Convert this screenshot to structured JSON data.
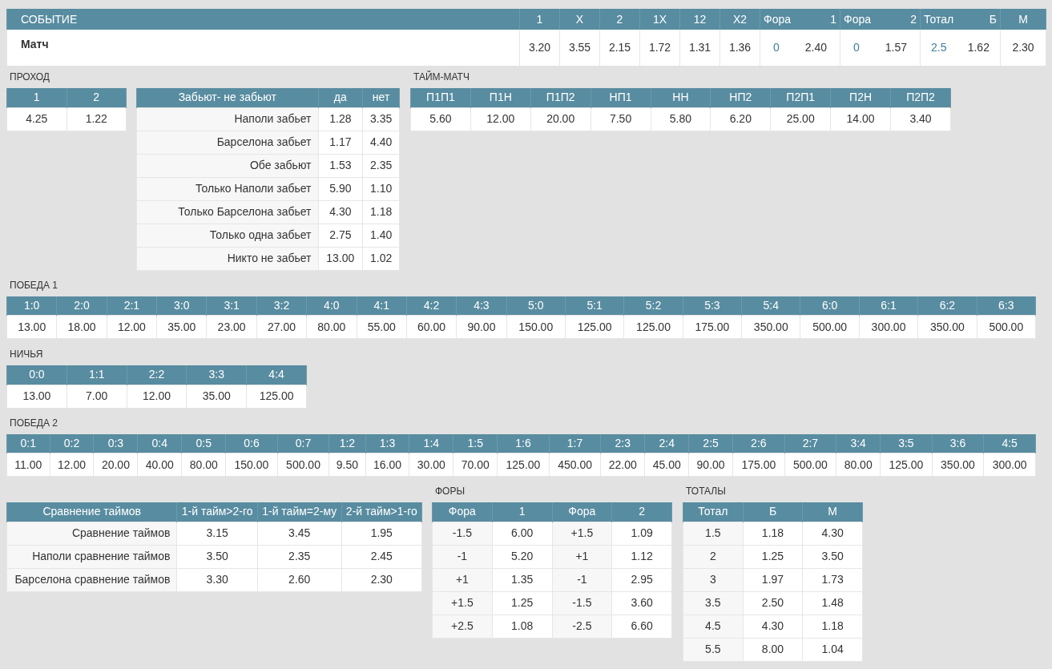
{
  "event": {
    "columns": [
      {
        "label": "СОБЫТИЕ"
      },
      {
        "label": "1"
      },
      {
        "label": "X"
      },
      {
        "label": "2"
      },
      {
        "label": "1X"
      },
      {
        "label": "12"
      },
      {
        "label": "X2"
      },
      {
        "label": "Фора",
        "label_2": "1"
      },
      {
        "label": "Фора",
        "label_2": "2"
      },
      {
        "label": "Тотал",
        "label_2": "Б"
      },
      {
        "label": "М"
      }
    ],
    "row": [
      {
        "kind": "name",
        "text": "Матч"
      },
      {
        "kind": "odd",
        "text": "3.20"
      },
      {
        "kind": "odd",
        "text": "3.55"
      },
      {
        "kind": "odd",
        "text": "2.15"
      },
      {
        "kind": "odd",
        "text": "1.72"
      },
      {
        "kind": "odd",
        "text": "1.31"
      },
      {
        "kind": "odd",
        "text": "1.36"
      },
      {
        "kind": "pair",
        "line": "0",
        "odd": "2.40"
      },
      {
        "kind": "pair",
        "line": "0",
        "odd": "1.57"
      },
      {
        "kind": "pair",
        "line": "2.5",
        "odd": "1.62"
      },
      {
        "kind": "odd",
        "text": "2.30"
      }
    ]
  },
  "passage": {
    "title": "ПРОХОД",
    "columns": [
      "1",
      "2"
    ],
    "rows": [
      [
        "4.25",
        "1.22"
      ]
    ]
  },
  "both_score": {
    "columns": [
      "Забьют- не забьют",
      "да",
      "нет"
    ],
    "rows": [
      [
        "Наполи забьет",
        "1.28",
        "3.35"
      ],
      [
        "Барселона забьет",
        "1.17",
        "4.40"
      ],
      [
        "Обе забьют",
        "1.53",
        "2.35"
      ],
      [
        "Только Наполи забьет",
        "5.90",
        "1.10"
      ],
      [
        "Только Барселона забьет",
        "4.30",
        "1.18"
      ],
      [
        "Только одна забьет",
        "2.75",
        "1.40"
      ],
      [
        "Никто не забьет",
        "13.00",
        "1.02"
      ]
    ]
  },
  "half_match": {
    "title": "ТАЙМ-МАТЧ",
    "columns": [
      "П1П1",
      "П1Н",
      "П1П2",
      "НП1",
      "НН",
      "НП2",
      "П2П1",
      "П2Н",
      "П2П2"
    ],
    "rows": [
      [
        "5.60",
        "12.00",
        "20.00",
        "7.50",
        "5.80",
        "6.20",
        "25.00",
        "14.00",
        "3.40"
      ]
    ]
  },
  "win_1": {
    "title": "ПОБЕДА 1",
    "columns": [
      "1:0",
      "2:0",
      "2:1",
      "3:0",
      "3:1",
      "3:2",
      "4:0",
      "4:1",
      "4:2",
      "4:3",
      "5:0",
      "5:1",
      "5:2",
      "5:3",
      "5:4",
      "6:0",
      "6:1",
      "6:2",
      "6:3"
    ],
    "rows": [
      [
        "13.00",
        "18.00",
        "12.00",
        "35.00",
        "23.00",
        "27.00",
        "80.00",
        "55.00",
        "60.00",
        "90.00",
        "150.00",
        "125.00",
        "125.00",
        "175.00",
        "350.00",
        "500.00",
        "300.00",
        "350.00",
        "500.00"
      ]
    ]
  },
  "draw": {
    "title": "НИЧЬЯ",
    "columns": [
      "0:0",
      "1:1",
      "2:2",
      "3:3",
      "4:4"
    ],
    "rows": [
      [
        "13.00",
        "7.00",
        "12.00",
        "35.00",
        "125.00"
      ]
    ]
  },
  "win_2": {
    "title": "ПОБЕДА 2",
    "columns": [
      "0:1",
      "0:2",
      "0:3",
      "0:4",
      "0:5",
      "0:6",
      "0:7",
      "1:2",
      "1:3",
      "1:4",
      "1:5",
      "1:6",
      "1:7",
      "2:3",
      "2:4",
      "2:5",
      "2:6",
      "2:7",
      "3:4",
      "3:5",
      "3:6",
      "4:5"
    ],
    "rows": [
      [
        "11.00",
        "12.00",
        "20.00",
        "40.00",
        "80.00",
        "150.00",
        "500.00",
        "9.50",
        "16.00",
        "30.00",
        "70.00",
        "125.00",
        "450.00",
        "22.00",
        "45.00",
        "90.00",
        "175.00",
        "500.00",
        "80.00",
        "125.00",
        "350.00",
        "300.00"
      ]
    ]
  },
  "halves": {
    "columns": [
      "Сравнение таймов",
      "1-й тайм>2-го",
      "1-й тайм=2-му",
      "2-й тайм>1-го"
    ],
    "rows": [
      [
        "Сравнение таймов",
        "3.15",
        "3.45",
        "1.95"
      ],
      [
        "Наполи сравнение таймов",
        "3.50",
        "2.35",
        "2.45"
      ],
      [
        "Барселона сравнение таймов",
        "3.30",
        "2.60",
        "2.30"
      ]
    ]
  },
  "handicaps": {
    "title": "ФОРЫ",
    "columns": [
      "Фора",
      "1",
      "Фора",
      "2"
    ],
    "rows": [
      [
        "-1.5",
        "6.00",
        "+1.5",
        "1.09"
      ],
      [
        "-1",
        "5.20",
        "+1",
        "1.12"
      ],
      [
        "+1",
        "1.35",
        "-1",
        "2.95"
      ],
      [
        "+1.5",
        "1.25",
        "-1.5",
        "3.60"
      ],
      [
        "+2.5",
        "1.08",
        "-2.5",
        "6.60"
      ]
    ]
  },
  "totals": {
    "title": "ТОТАЛЫ",
    "columns": [
      "Тотал",
      "Б",
      "М"
    ],
    "rows": [
      [
        "1.5",
        "1.18",
        "4.30"
      ],
      [
        "2",
        "1.25",
        "3.50"
      ],
      [
        "3",
        "1.97",
        "1.73"
      ],
      [
        "3.5",
        "2.50",
        "1.48"
      ],
      [
        "4.5",
        "4.30",
        "1.18"
      ],
      [
        "5.5",
        "8.00",
        "1.04"
      ]
    ]
  }
}
